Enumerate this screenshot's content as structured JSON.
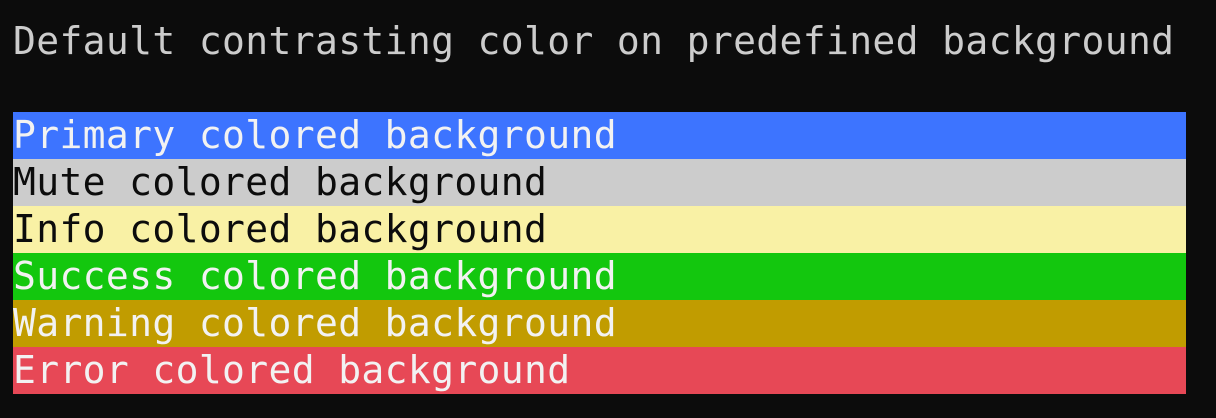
{
  "terminal": {
    "heading": "Default contrasting color on predefined background",
    "heading_color": "#cccccc",
    "background_color": "#0c0c0c",
    "rows": [
      {
        "name": "primary",
        "label": "Primary colored background",
        "bg": "#3d74ff",
        "fg": "#f2f2f2"
      },
      {
        "name": "mute",
        "label": "Mute colored background",
        "bg": "#cccccc",
        "fg": "#0c0c0c"
      },
      {
        "name": "info",
        "label": "Info colored background",
        "bg": "#f9f1a5",
        "fg": "#0c0c0c"
      },
      {
        "name": "success",
        "label": "Success colored background",
        "bg": "#13c70e",
        "fg": "#f2f2f2"
      },
      {
        "name": "warning",
        "label": "Warning colored background",
        "bg": "#c19c00",
        "fg": "#f2f2f2"
      },
      {
        "name": "error",
        "label": "Error colored background",
        "bg": "#e74856",
        "fg": "#f2f2f2"
      }
    ]
  }
}
